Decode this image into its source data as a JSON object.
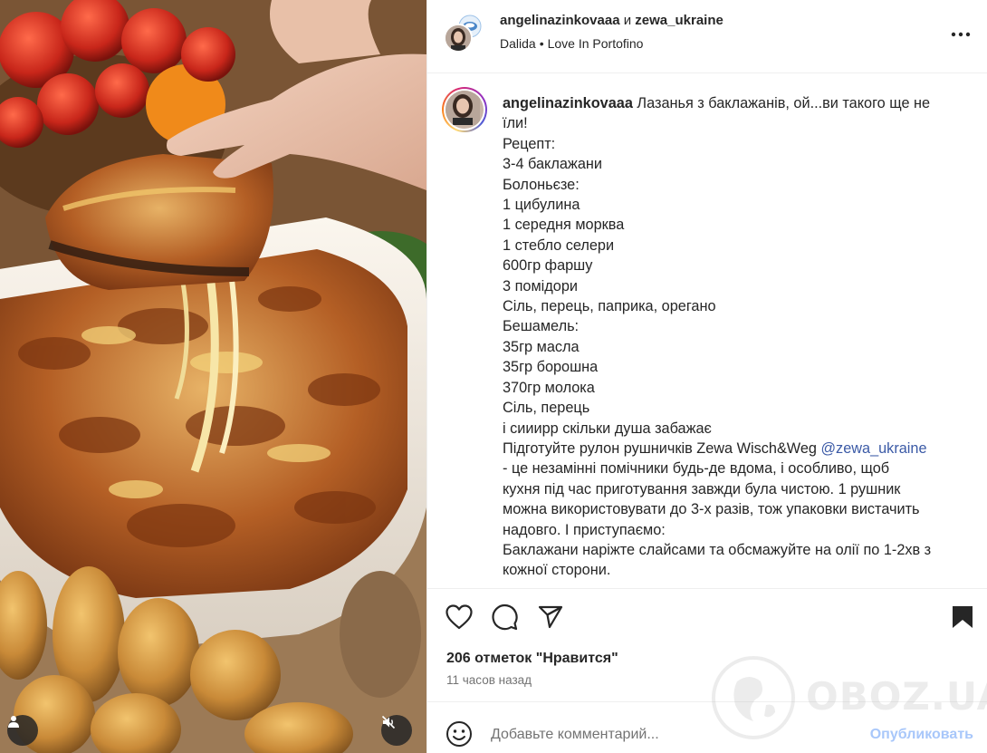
{
  "header": {
    "user1": "angelinazinkovaaa",
    "conjunction": "и",
    "user2": "zewa_ukraine",
    "audio_artist": "Dalida",
    "audio_dot": "•",
    "audio_track": "Love In Portofino",
    "more_icon": "more-horizontal-icon"
  },
  "caption": {
    "username": "angelinazinkovaaa",
    "lines": [
      "Лазанья з баклажанів, ой...ви такого ще не",
      "їли!",
      "Рецепт:",
      "3-4 баклажани",
      "Болоньєзе:",
      "1 цибулина",
      "1 середня морква",
      "1 стебло селери",
      "600гр фаршу",
      "3 помідори",
      "Сіль, перець, паприка, орегано",
      "Бешамель:",
      "35гр масла",
      "35гр борошна",
      "370гр молока",
      "Сіль, перець",
      "і сииирр скільки душа забажає",
      "Підготуйте рулон рушничків Zewa Wisch&Weg"
    ],
    "mention": "@zewa_ukraine",
    "lines_after": [
      "- це незамінні помічники будь-де вдома, і особливо, щоб",
      "кухня під час приготування завжди була чистою. 1 рушник",
      "можна використовувати до 3-х разів, тож упаковки вистачить",
      "надовго. І приступаємо:",
      "Баклажани наріжте слайсами та обсмажуйте на олії по 1-2хв з",
      "кожної сторони."
    ]
  },
  "actions": {
    "like_icon": "heart-icon",
    "comment_icon": "comment-icon",
    "share_icon": "share-icon",
    "save_icon": "bookmark-icon",
    "likes": "206 отметок \"Нравится\"",
    "time_ago": "11 часов назад"
  },
  "comment": {
    "emoji_icon": "emoji-icon",
    "placeholder": "Добавьте комментарий...",
    "post_label": "Опубликовать"
  },
  "media": {
    "tag_icon": "user-tag-icon",
    "mute_icon": "speaker-muted-icon"
  },
  "watermark": {
    "text": "OBOZ.UA"
  },
  "colors": {
    "mention": "#3b5aa6",
    "post_button": "#a8c7fa",
    "muted_text": "#737373",
    "divider": "#efefef"
  }
}
